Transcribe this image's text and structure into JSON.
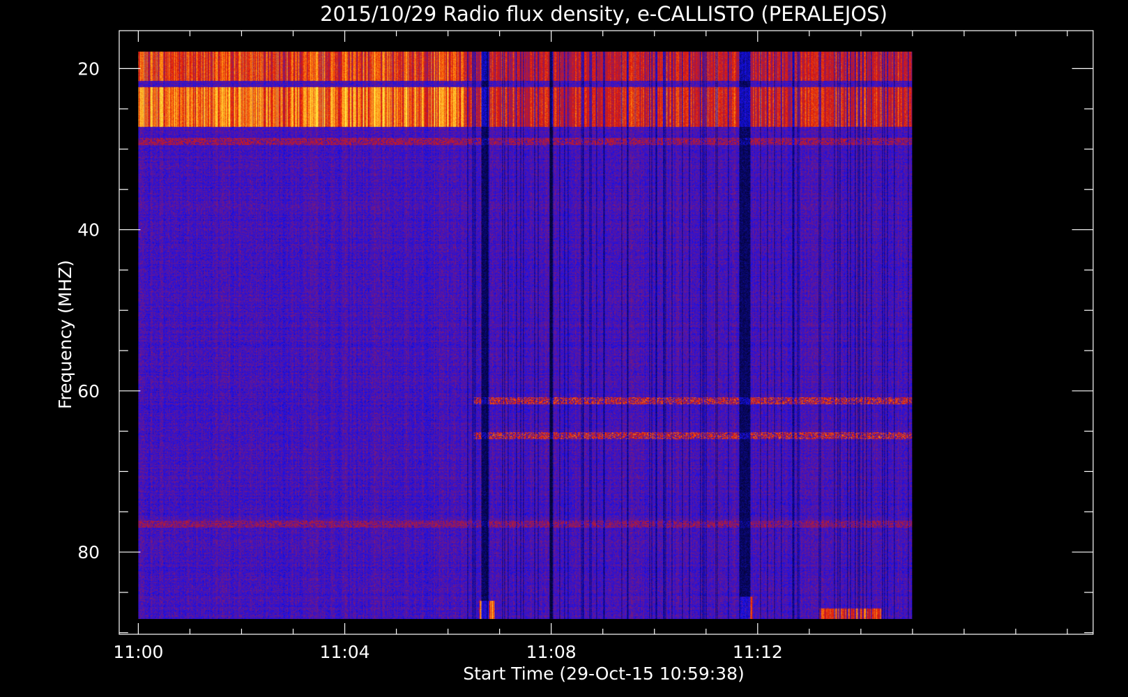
{
  "chart_data": {
    "type": "heatmap",
    "title": "2015/10/29  Radio flux density, e-CALLISTO (PERALEJOS)",
    "xlabel": "Start Time (29-Oct-15 10:59:38)",
    "ylabel": "Frequency (MHZ)",
    "x_axis": {
      "unit": "minutes after 11:00",
      "range_minutes": [
        -0.37,
        18.5
      ],
      "data_extent_minutes": [
        0,
        15
      ],
      "major_ticks": [
        {
          "minute": 0,
          "label": "11:00"
        },
        {
          "minute": 4,
          "label": "11:04"
        },
        {
          "minute": 8,
          "label": "11:08"
        },
        {
          "minute": 12,
          "label": "11:12"
        }
      ],
      "minor_tick_step_minutes": 1
    },
    "y_axis": {
      "unit": "MHz",
      "range": [
        15.3,
        90.2
      ],
      "inverted": true,
      "data_extent": [
        17.9,
        88.3
      ],
      "major_ticks": [
        20,
        40,
        60,
        80
      ],
      "minor_tick_step": 5
    },
    "colormap": [
      "#000000",
      "#1410f0",
      "#8a1a66",
      "#e01808",
      "#ff8a10",
      "#ffe040"
    ],
    "background_level": 0.28,
    "features": [
      {
        "kind": "band",
        "freq_range": [
          17.9,
          21.5
        ],
        "time_range": [
          0,
          15
        ],
        "intensity_early": 0.75,
        "intensity_late": 0.6
      },
      {
        "kind": "band",
        "freq_range": [
          22.3,
          27.2
        ],
        "time_range": [
          0,
          15
        ],
        "intensity_early": 0.9,
        "intensity_late": 0.65
      },
      {
        "kind": "line",
        "freq": 29,
        "intensity": 0.55
      },
      {
        "kind": "line",
        "freq": 61.2,
        "time_range": [
          6.5,
          15
        ],
        "intensity": 0.7
      },
      {
        "kind": "line",
        "freq": 65.5,
        "time_range": [
          6.5,
          15
        ],
        "intensity": 0.7
      },
      {
        "kind": "line",
        "freq": 76.5,
        "intensity": 0.5
      },
      {
        "kind": "gap",
        "time": 6.7,
        "width_minutes": 0.12
      },
      {
        "kind": "gap",
        "time": 8.0,
        "width_minutes": 0.08
      },
      {
        "kind": "gap",
        "time": 11.75,
        "width_minutes": 0.22
      },
      {
        "kind": "band",
        "freq_range": [
          86,
          88.3
        ],
        "time_range": [
          6.6,
          6.9
        ],
        "intensity": 0.8
      },
      {
        "kind": "band",
        "freq_range": [
          85.5,
          88.3
        ],
        "time_range": [
          11.65,
          11.9
        ],
        "intensity": 0.85
      },
      {
        "kind": "band",
        "freq_range": [
          87,
          88.3
        ],
        "time_range": [
          13.2,
          14.4
        ],
        "intensity": 0.7
      }
    ]
  }
}
